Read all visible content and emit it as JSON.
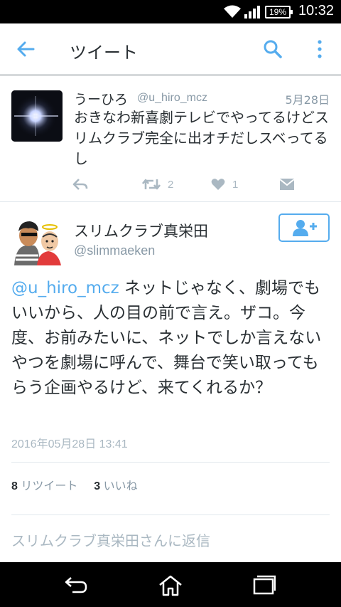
{
  "status_bar": {
    "battery": "19%",
    "time": "10:32"
  },
  "app_bar": {
    "title": "ツイート"
  },
  "reply_tweet": {
    "author_name": "うーひろ",
    "author_handle": "@u_hiro_mcz",
    "date": "5月28日",
    "text": "おきなわ新喜劇テレビでやってるけどスリムクラブ完全に出オチだしスベってるし",
    "retweet_count": "2",
    "like_count": "1"
  },
  "main_tweet": {
    "author_name": "スリムクラブ真栄田",
    "author_handle": "@slimmaeken",
    "mention": "@u_hiro_mcz",
    "text": " ネットじゃなく、劇場でもいいから、人の目の前で言え。ザコ。今度、お前みたいに、ネットでしか言えないやつを劇場に呼んで、舞台で笑い取ってもらう企画やるけど、来てくれるか？",
    "timestamp": "2016年05月28日 13:41",
    "retweets": "8",
    "retweets_label": "リツイート",
    "likes": "3",
    "likes_label": "いいね"
  },
  "reply_prompt": "スリムクラブ真栄田さんに返信",
  "colors": {
    "accent": "#55acee",
    "muted": "#aab8c2",
    "text": "#292f33"
  }
}
